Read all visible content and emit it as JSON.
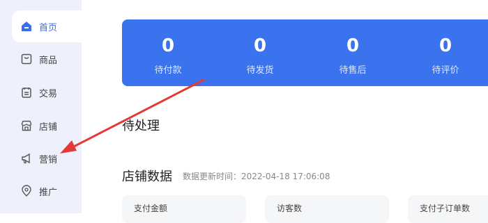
{
  "sidebar": {
    "items": [
      {
        "label": "首页",
        "icon": "home-icon",
        "active": true
      },
      {
        "label": "商品",
        "icon": "product-icon",
        "active": false
      },
      {
        "label": "交易",
        "icon": "trade-icon",
        "active": false
      },
      {
        "label": "店铺",
        "icon": "store-icon",
        "active": false
      },
      {
        "label": "营销",
        "icon": "megaphone-icon",
        "active": false
      },
      {
        "label": "推广",
        "icon": "location-pin-icon",
        "active": false
      }
    ]
  },
  "stats": [
    {
      "value": "0",
      "label": "待付款"
    },
    {
      "value": "0",
      "label": "待发货"
    },
    {
      "value": "0",
      "label": "待售后"
    },
    {
      "value": "0",
      "label": "待评价"
    }
  ],
  "pending": {
    "title": "待处理"
  },
  "store_data": {
    "title": "店铺数据",
    "update_time": "数据更新时间：2022-04-18 17:06:08",
    "metrics": [
      {
        "label": "支付金额"
      },
      {
        "label": "访客数"
      },
      {
        "label": "支付子订单数"
      }
    ]
  },
  "colors": {
    "accent": "#3b73ee",
    "sidebar_bg": "#eef1fb",
    "arrow": "#e53935"
  }
}
